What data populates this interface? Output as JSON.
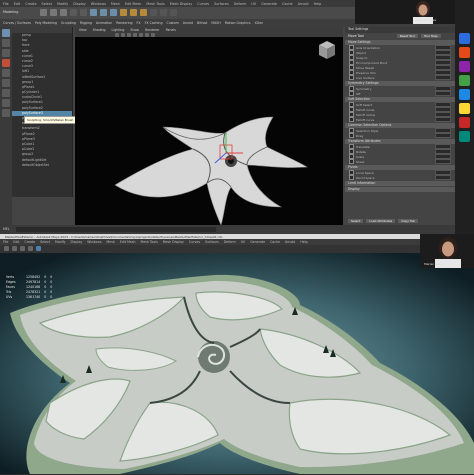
{
  "top_window": {
    "menu": [
      "File",
      "Edit",
      "Create",
      "Select",
      "Modify",
      "Display",
      "Windows",
      "Mesh",
      "Edit Mesh",
      "Mesh Tools",
      "Mesh Display",
      "Curves",
      "Surfaces",
      "Deform",
      "UV",
      "Generate",
      "Cache",
      "Arnold",
      "Help"
    ],
    "workspace_label": "Modeling",
    "shelf_tabs": [
      "Curves / Surfaces",
      "Poly Modeling",
      "Sculpting",
      "Rigging",
      "Animation",
      "Rendering",
      "FX",
      "FX Caching",
      "Custom",
      "Arnold",
      "Bifrost",
      "MASH",
      "Motion Graphics",
      "XGen"
    ],
    "viewport_menu": [
      "View",
      "Shading",
      "Lighting",
      "Show",
      "Renderer",
      "Panels"
    ],
    "viewport_tabs": [
      "Outliner",
      "Display",
      "Show",
      "Help"
    ],
    "outliner_items": [
      {
        "label": "persp",
        "selected": false
      },
      {
        "label": "top",
        "selected": false
      },
      {
        "label": "front",
        "selected": false
      },
      {
        "label": "side",
        "selected": false
      },
      {
        "label": "curve1",
        "selected": false
      },
      {
        "label": "curve2",
        "selected": false
      },
      {
        "label": "curve3",
        "selected": false
      },
      {
        "label": "loft1",
        "selected": false
      },
      {
        "label": "loftedSurface1",
        "selected": false
      },
      {
        "label": "group1",
        "selected": false
      },
      {
        "label": "pPlane1",
        "selected": false
      },
      {
        "label": "pCylinder1",
        "selected": false
      },
      {
        "label": "nurbsCircle1",
        "selected": false
      },
      {
        "label": "polySurface1",
        "selected": false
      },
      {
        "label": "polySurface2",
        "selected": false
      },
      {
        "label": "polySurface3",
        "selected": true
      },
      {
        "label": "polySurface4",
        "selected": false
      },
      {
        "label": "transform1",
        "selected": false
      },
      {
        "label": "transform2",
        "selected": false
      },
      {
        "label": "pPlane2",
        "selected": false
      },
      {
        "label": "pPlane3",
        "selected": false
      },
      {
        "label": "pCube1",
        "selected": false
      },
      {
        "label": "pCube2",
        "selected": false
      },
      {
        "label": "group2",
        "selected": false
      },
      {
        "label": "defaultLightSet",
        "selected": false
      },
      {
        "label": "defaultObjectSet",
        "selected": false
      }
    ],
    "tooltip": "Sculpting: Smooth/Relax Brush",
    "attribute_editor": {
      "title": "Tool Settings",
      "tool_name": "Move Tool",
      "buttons": [
        "Reset Tool",
        "Tool Help"
      ],
      "sections": [
        {
          "name": "Move Settings",
          "rows": [
            "Axis Orientation",
            "Object",
            "Snap to",
            "Pin Component Pivot",
            "Move Tweak",
            "Preserve UVs",
            "Live Surface"
          ]
        },
        {
          "name": "Symmetry Settings",
          "rows": [
            "Symmetry",
            "Off"
          ]
        },
        {
          "name": "Soft Selection",
          "rows": [
            "Soft Select",
            "Falloff mode",
            "Falloff radius",
            "Falloff curve"
          ]
        },
        {
          "name": "Common Selection Options",
          "rows": [
            "Selection Style",
            "Drag"
          ]
        },
        {
          "name": "Transform Attributes",
          "rows": [
            "Translate",
            "Rotate",
            "Scale",
            "Shear"
          ]
        },
        {
          "name": "Pivots",
          "rows": [
            "Local Space",
            "World Space"
          ]
        },
        {
          "name": "Limit Information",
          "rows": []
        },
        {
          "name": "Display",
          "rows": []
        }
      ],
      "bottom_tabs": [
        "Select",
        "Load Attributes",
        "Copy Tab"
      ]
    },
    "status_text": "MEL"
  },
  "webcam_top": {
    "label": "Marlen Kales"
  },
  "right_apps": [
    {
      "name": "app-icon-1",
      "color": "#2d6cdf"
    },
    {
      "name": "app-icon-2",
      "color": "#e64a19"
    },
    {
      "name": "app-icon-3",
      "color": "#8e24aa"
    },
    {
      "name": "app-icon-4",
      "color": "#43a047"
    },
    {
      "name": "app-icon-5",
      "color": "#1e88e5"
    },
    {
      "name": "app-icon-6",
      "color": "#fdd835"
    },
    {
      "name": "app-icon-7",
      "color": "#c62828"
    },
    {
      "name": "app-icon-8",
      "color": "#00897b"
    }
  ],
  "bottom_window": {
    "title": "MasterPlanExterior - Autodesk Maya 2023 - C:\\Users\\marlen\\OneDrive\\Documents\\maya\\projects\\default\\scenes\\MasterPlanExterior_Close01.mb",
    "menu": [
      "File",
      "Edit",
      "Create",
      "Select",
      "Modify",
      "Display",
      "Windows",
      "Mesh",
      "Edit Mesh",
      "Mesh Tools",
      "Mesh Display",
      "Curves",
      "Surfaces",
      "Deform",
      "UV",
      "Generate",
      "Cache",
      "Arnold",
      "Help"
    ],
    "hud": [
      {
        "label": "Verts",
        "values": [
          "1258492",
          "0",
          "0"
        ]
      },
      {
        "label": "Edges",
        "values": [
          "2497814",
          "0",
          "0"
        ]
      },
      {
        "label": "Faces",
        "values": [
          "1240168",
          "0",
          "0"
        ]
      },
      {
        "label": "Tris",
        "values": [
          "2478321",
          "0",
          "0"
        ]
      },
      {
        "label": "UVs",
        "values": [
          "1361740",
          "0",
          "0"
        ]
      }
    ]
  },
  "webcam_bottom": {
    "label": "Marlen Kales"
  }
}
